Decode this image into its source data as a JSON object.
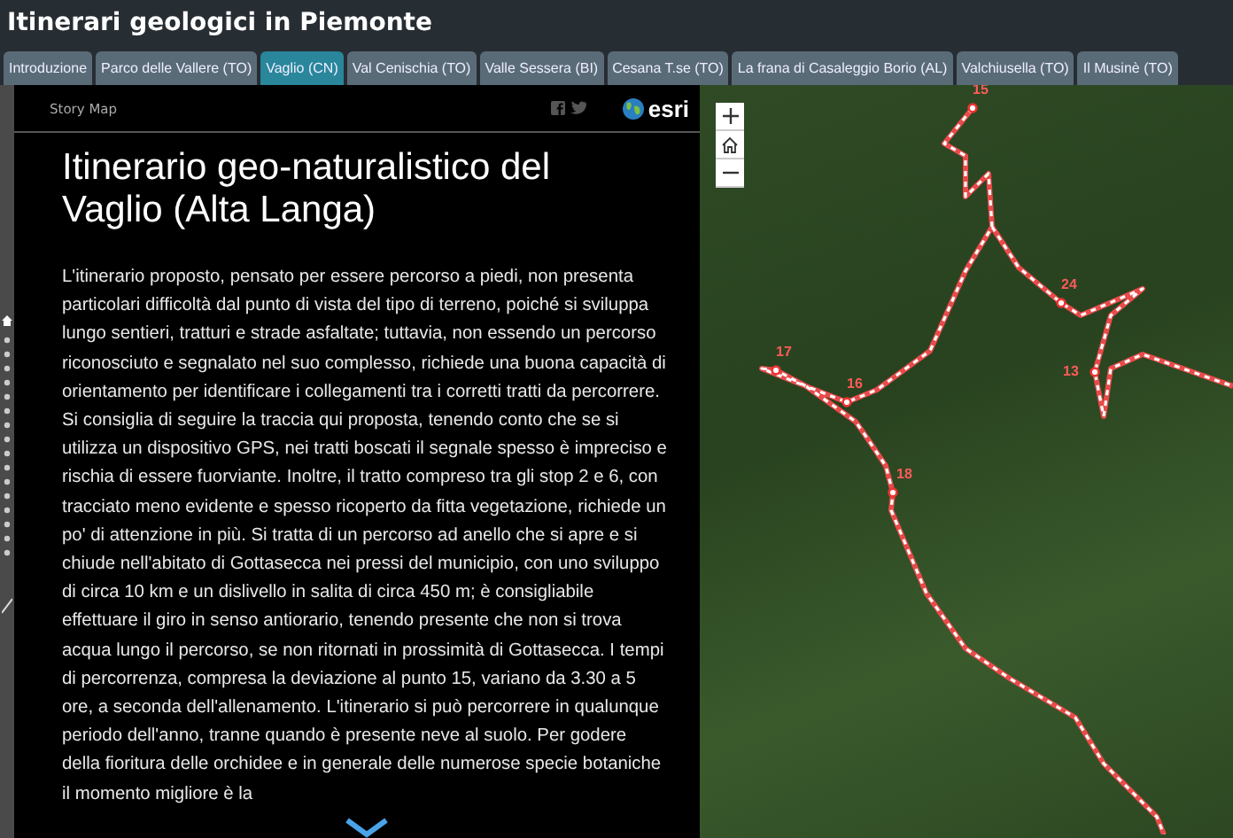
{
  "header": {
    "title": "Itinerari geologici in Piemonte"
  },
  "tabs": [
    {
      "label": "Introduzione",
      "selected": false
    },
    {
      "label": "Parco delle Vallere (TO)",
      "selected": false
    },
    {
      "label": "Vaglio (CN)",
      "selected": true
    },
    {
      "label": "Val Cenischia (TO)",
      "selected": false
    },
    {
      "label": "Valle Sessera (BI)",
      "selected": false
    },
    {
      "label": "Cesana T.se (TO)",
      "selected": false
    },
    {
      "label": "La frana di Casaleggio Borio (AL)",
      "selected": false
    },
    {
      "label": "Valchiusella (TO)",
      "selected": false
    },
    {
      "label": "Il Musinè (TO)",
      "selected": false
    }
  ],
  "panel": {
    "label": "Story Map",
    "logo": "esri",
    "title": "Itinerario geo-naturalistico del Vaglio (Alta Langa)",
    "body": "L'itinerario proposto, pensato per essere percorso a piedi, non presenta particolari difficoltà dal punto di vista del tipo di terreno, poiché si sviluppa lungo sentieri, tratturi e strade asfaltate; tuttavia, non essendo un percorso riconosciuto e segnalato nel suo complesso, richiede una buona capacità di orientamento per identificare i collegamenti tra i corretti tratti da percorrere. Si consiglia di seguire la traccia qui proposta, tenendo conto che se si utilizza un dispositivo GPS, nei tratti boscati il segnale spesso è impreciso e rischia di essere fuorviante. Inoltre, il tratto compreso tra gli stop 2 e 6, con tracciato meno evidente e spesso ricoperto da fitta vegetazione, richiede un po' di attenzione in più. Si tratta di un percorso ad anello che si apre e si chiude nell'abitato di Gottasecca nei pressi del municipio, con uno sviluppo di circa 10 km e un dislivello in salita di circa 450 m; è consigliabile effettuare il giro in senso antiorario, tenendo presente che non si trova acqua lungo il percorso, se non ritornati in prossimità di Gottasecca. I tempi di percorrenza, compresa la deviazione al punto 15, variano da 3.30 a 5 ore, a seconda dell'allenamento. L'itinerario si può percorrere in qualunque periodo dell'anno, tranne quando è presente neve al suolo. Per godere della fioritura delle orchidee e in generale delle numerose specie botaniche il momento migliore è la"
  },
  "map": {
    "markers": [
      {
        "label": "15"
      },
      {
        "label": "24"
      },
      {
        "label": "13"
      },
      {
        "label": "17"
      },
      {
        "label": "16"
      },
      {
        "label": "18"
      }
    ]
  }
}
